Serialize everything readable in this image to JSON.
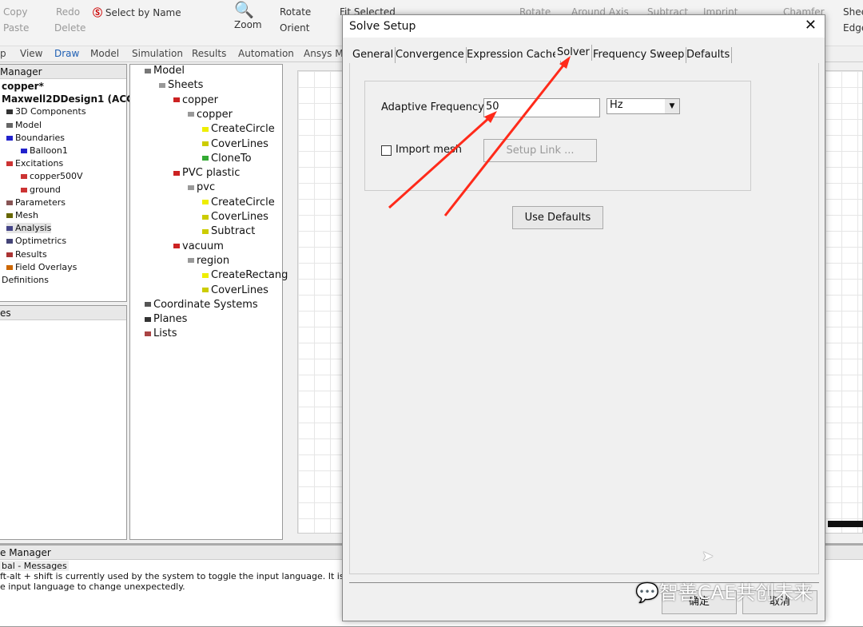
{
  "ribbon": {
    "copy": "Copy",
    "redo": "Redo",
    "paste": "Paste",
    "delete": "Delete",
    "select_by_name": "Select by Name",
    "zoom": "Zoom",
    "rotate": "Rotate",
    "orient": "Orient",
    "fit_selected": "Fit Selected",
    "rotate2": "Rotate",
    "around_axis": "Around Axis",
    "subtract": "Subtract",
    "imprint": "Imprint",
    "chamfer": "Chamfer",
    "sheet": "Shee",
    "edge": "Edge"
  },
  "menu_tabs": [
    "p",
    "View",
    "Draw",
    "Model",
    "Simulation",
    "Results",
    "Automation",
    "Ansys Mi"
  ],
  "project_manager": {
    "title": "Manager",
    "items": [
      "copper*",
      "Maxwell2DDesign1 (ACC",
      "3D Components",
      "Model",
      "Boundaries",
      "Balloon1",
      "Excitations",
      "copper500V",
      "ground",
      "Parameters",
      "Mesh",
      "Analysis",
      "Optimetrics",
      "Results",
      "Field Overlays",
      "Definitions"
    ]
  },
  "properties_panel": {
    "title": "es"
  },
  "model_tree": [
    "Model",
    "Sheets",
    "copper",
    "copper",
    "CreateCircle",
    "CoverLines",
    "CloneTo",
    "PVC plastic",
    "pvc",
    "CreateCircle",
    "CoverLines",
    "Subtract",
    "vacuum",
    "region",
    "CreateRectang",
    "CoverLines",
    "Coordinate Systems",
    "Planes",
    "Lists"
  ],
  "message_manager": {
    "title": "e Manager",
    "tab": "bal - Messages",
    "line1": "ft-alt + shift is currently used by the system to toggle the input language. It is also us",
    "line2": "e input language to change unexpectedly."
  },
  "dialog": {
    "title": "Solve Setup",
    "tabs": [
      "General",
      "Convergence",
      "Expression Cache",
      "Solver",
      "Frequency Sweep",
      "Defaults"
    ],
    "active_tab": "Solver",
    "adaptive_frequency_label": "Adaptive Frequency:",
    "adaptive_frequency_value": "50",
    "unit": "Hz",
    "import_mesh_label": "Import mesh",
    "import_mesh_checked": false,
    "setup_link": "Setup Link ...",
    "use_defaults": "Use Defaults",
    "ok": "确定",
    "cancel": "取消"
  },
  "watermark": "智善CAE共创未来",
  "colors": {
    "accent": "#1e5fb4",
    "annotation": "#ff2a1a"
  }
}
